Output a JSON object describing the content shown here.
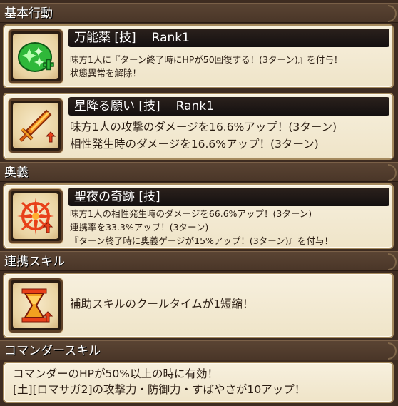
{
  "sections": {
    "basic": {
      "label": "基本行動"
    },
    "ougi": {
      "label": "奥義"
    },
    "renkei": {
      "label": "連携スキル"
    },
    "commander": {
      "label": "コマンダースキル"
    }
  },
  "skills": {
    "skill1": {
      "name": "万能薬 [技]",
      "rank": "Rank1",
      "icon": "green-sparkle-heal-icon",
      "lines": [
        "味方1人に『ターン終了時にHPが50回復する！(3ターン)』を付与！",
        "状態異常を解除！"
      ]
    },
    "skill2": {
      "name": "星降る願い [技]",
      "rank": "Rank1",
      "icon": "flaming-sword-up-icon",
      "lines": [
        "味方1人の攻撃のダメージを16.6%アップ！(3ターン)",
        "相性発生時のダメージを16.6%アップ！(3ターン)"
      ]
    },
    "ougi": {
      "name": "聖夜の奇跡 [技]",
      "icon": "red-burst-circle-icon",
      "lines": [
        "味方1人の相性発生時のダメージを66.6%アップ！(3ターン)",
        "連携率を33.3%アップ！(3ターン)",
        "『ターン終了時に奥義ゲージが15%アップ！(3ターン)』を付与！"
      ]
    },
    "renkei": {
      "icon": "hourglass-cooldown-icon",
      "lines": [
        "補助スキルのクールタイムが1短縮！"
      ]
    },
    "commander": {
      "lines": [
        "コマンダーのHPが50%以上の時に有効！",
        "[土][ロマサガ2]の攻撃力・防御力・すばやさが10アップ！"
      ]
    }
  },
  "colors": {
    "background": "#3e2c21",
    "card": "#f3ead2",
    "title_bar": "#1c1614",
    "text": "#2a1c12"
  }
}
